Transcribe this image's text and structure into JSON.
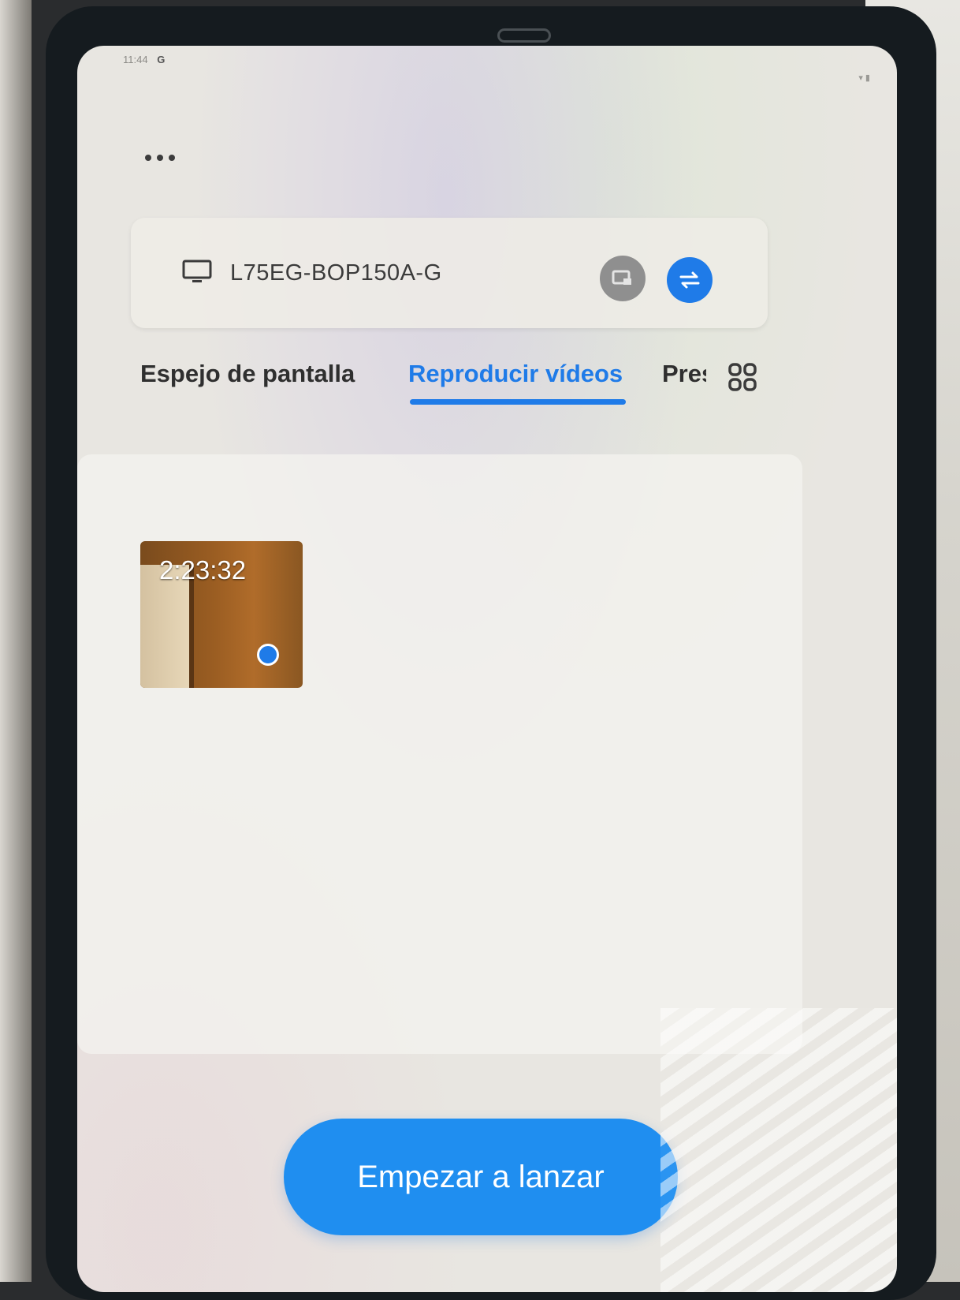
{
  "status_bar": {
    "time": "11:44",
    "left_icons": "G",
    "right_icons": "▾ ▮"
  },
  "more_menu": {
    "icon": "more-horizontal-icon"
  },
  "device_card": {
    "device_name": "L75EG-BOP150A-G",
    "tv_icon": "tv-icon",
    "secondary_icon": "screen-mirror-icon",
    "primary_icon": "switch-device-icon"
  },
  "tabs": {
    "items": [
      {
        "label": "Espejo de pantalla",
        "active": false
      },
      {
        "label": "Reproducir vídeos",
        "active": true
      },
      {
        "label": "Presentación",
        "active": false
      }
    ],
    "more_icon": "grid-apps-icon"
  },
  "videos": [
    {
      "duration": "2:23:32",
      "selected": true
    }
  ],
  "actions": {
    "start_cast_label": "Empezar a lanzar"
  },
  "colors": {
    "accent": "#1f7be8",
    "button": "#1f8ef0",
    "text_primary": "#2f2f2f"
  }
}
